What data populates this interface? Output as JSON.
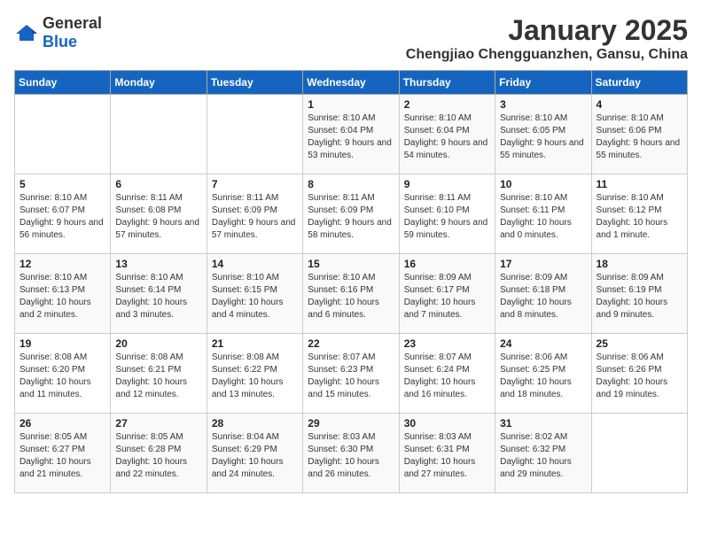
{
  "header": {
    "logo": {
      "general": "General",
      "blue": "Blue"
    },
    "title": "January 2025",
    "subtitle": "Chengjiao Chengguanzhen, Gansu, China"
  },
  "weekdays": [
    "Sunday",
    "Monday",
    "Tuesday",
    "Wednesday",
    "Thursday",
    "Friday",
    "Saturday"
  ],
  "weeks": [
    [
      {
        "day": "",
        "sunrise": "",
        "sunset": "",
        "daylight": ""
      },
      {
        "day": "",
        "sunrise": "",
        "sunset": "",
        "daylight": ""
      },
      {
        "day": "",
        "sunrise": "",
        "sunset": "",
        "daylight": ""
      },
      {
        "day": "1",
        "sunrise": "Sunrise: 8:10 AM",
        "sunset": "Sunset: 6:04 PM",
        "daylight": "Daylight: 9 hours and 53 minutes."
      },
      {
        "day": "2",
        "sunrise": "Sunrise: 8:10 AM",
        "sunset": "Sunset: 6:04 PM",
        "daylight": "Daylight: 9 hours and 54 minutes."
      },
      {
        "day": "3",
        "sunrise": "Sunrise: 8:10 AM",
        "sunset": "Sunset: 6:05 PM",
        "daylight": "Daylight: 9 hours and 55 minutes."
      },
      {
        "day": "4",
        "sunrise": "Sunrise: 8:10 AM",
        "sunset": "Sunset: 6:06 PM",
        "daylight": "Daylight: 9 hours and 55 minutes."
      }
    ],
    [
      {
        "day": "5",
        "sunrise": "Sunrise: 8:10 AM",
        "sunset": "Sunset: 6:07 PM",
        "daylight": "Daylight: 9 hours and 56 minutes."
      },
      {
        "day": "6",
        "sunrise": "Sunrise: 8:11 AM",
        "sunset": "Sunset: 6:08 PM",
        "daylight": "Daylight: 9 hours and 57 minutes."
      },
      {
        "day": "7",
        "sunrise": "Sunrise: 8:11 AM",
        "sunset": "Sunset: 6:09 PM",
        "daylight": "Daylight: 9 hours and 57 minutes."
      },
      {
        "day": "8",
        "sunrise": "Sunrise: 8:11 AM",
        "sunset": "Sunset: 6:09 PM",
        "daylight": "Daylight: 9 hours and 58 minutes."
      },
      {
        "day": "9",
        "sunrise": "Sunrise: 8:11 AM",
        "sunset": "Sunset: 6:10 PM",
        "daylight": "Daylight: 9 hours and 59 minutes."
      },
      {
        "day": "10",
        "sunrise": "Sunrise: 8:10 AM",
        "sunset": "Sunset: 6:11 PM",
        "daylight": "Daylight: 10 hours and 0 minutes."
      },
      {
        "day": "11",
        "sunrise": "Sunrise: 8:10 AM",
        "sunset": "Sunset: 6:12 PM",
        "daylight": "Daylight: 10 hours and 1 minute."
      }
    ],
    [
      {
        "day": "12",
        "sunrise": "Sunrise: 8:10 AM",
        "sunset": "Sunset: 6:13 PM",
        "daylight": "Daylight: 10 hours and 2 minutes."
      },
      {
        "day": "13",
        "sunrise": "Sunrise: 8:10 AM",
        "sunset": "Sunset: 6:14 PM",
        "daylight": "Daylight: 10 hours and 3 minutes."
      },
      {
        "day": "14",
        "sunrise": "Sunrise: 8:10 AM",
        "sunset": "Sunset: 6:15 PM",
        "daylight": "Daylight: 10 hours and 4 minutes."
      },
      {
        "day": "15",
        "sunrise": "Sunrise: 8:10 AM",
        "sunset": "Sunset: 6:16 PM",
        "daylight": "Daylight: 10 hours and 6 minutes."
      },
      {
        "day": "16",
        "sunrise": "Sunrise: 8:09 AM",
        "sunset": "Sunset: 6:17 PM",
        "daylight": "Daylight: 10 hours and 7 minutes."
      },
      {
        "day": "17",
        "sunrise": "Sunrise: 8:09 AM",
        "sunset": "Sunset: 6:18 PM",
        "daylight": "Daylight: 10 hours and 8 minutes."
      },
      {
        "day": "18",
        "sunrise": "Sunrise: 8:09 AM",
        "sunset": "Sunset: 6:19 PM",
        "daylight": "Daylight: 10 hours and 9 minutes."
      }
    ],
    [
      {
        "day": "19",
        "sunrise": "Sunrise: 8:08 AM",
        "sunset": "Sunset: 6:20 PM",
        "daylight": "Daylight: 10 hours and 11 minutes."
      },
      {
        "day": "20",
        "sunrise": "Sunrise: 8:08 AM",
        "sunset": "Sunset: 6:21 PM",
        "daylight": "Daylight: 10 hours and 12 minutes."
      },
      {
        "day": "21",
        "sunrise": "Sunrise: 8:08 AM",
        "sunset": "Sunset: 6:22 PM",
        "daylight": "Daylight: 10 hours and 13 minutes."
      },
      {
        "day": "22",
        "sunrise": "Sunrise: 8:07 AM",
        "sunset": "Sunset: 6:23 PM",
        "daylight": "Daylight: 10 hours and 15 minutes."
      },
      {
        "day": "23",
        "sunrise": "Sunrise: 8:07 AM",
        "sunset": "Sunset: 6:24 PM",
        "daylight": "Daylight: 10 hours and 16 minutes."
      },
      {
        "day": "24",
        "sunrise": "Sunrise: 8:06 AM",
        "sunset": "Sunset: 6:25 PM",
        "daylight": "Daylight: 10 hours and 18 minutes."
      },
      {
        "day": "25",
        "sunrise": "Sunrise: 8:06 AM",
        "sunset": "Sunset: 6:26 PM",
        "daylight": "Daylight: 10 hours and 19 minutes."
      }
    ],
    [
      {
        "day": "26",
        "sunrise": "Sunrise: 8:05 AM",
        "sunset": "Sunset: 6:27 PM",
        "daylight": "Daylight: 10 hours and 21 minutes."
      },
      {
        "day": "27",
        "sunrise": "Sunrise: 8:05 AM",
        "sunset": "Sunset: 6:28 PM",
        "daylight": "Daylight: 10 hours and 22 minutes."
      },
      {
        "day": "28",
        "sunrise": "Sunrise: 8:04 AM",
        "sunset": "Sunset: 6:29 PM",
        "daylight": "Daylight: 10 hours and 24 minutes."
      },
      {
        "day": "29",
        "sunrise": "Sunrise: 8:03 AM",
        "sunset": "Sunset: 6:30 PM",
        "daylight": "Daylight: 10 hours and 26 minutes."
      },
      {
        "day": "30",
        "sunrise": "Sunrise: 8:03 AM",
        "sunset": "Sunset: 6:31 PM",
        "daylight": "Daylight: 10 hours and 27 minutes."
      },
      {
        "day": "31",
        "sunrise": "Sunrise: 8:02 AM",
        "sunset": "Sunset: 6:32 PM",
        "daylight": "Daylight: 10 hours and 29 minutes."
      },
      {
        "day": "",
        "sunrise": "",
        "sunset": "",
        "daylight": ""
      }
    ]
  ]
}
